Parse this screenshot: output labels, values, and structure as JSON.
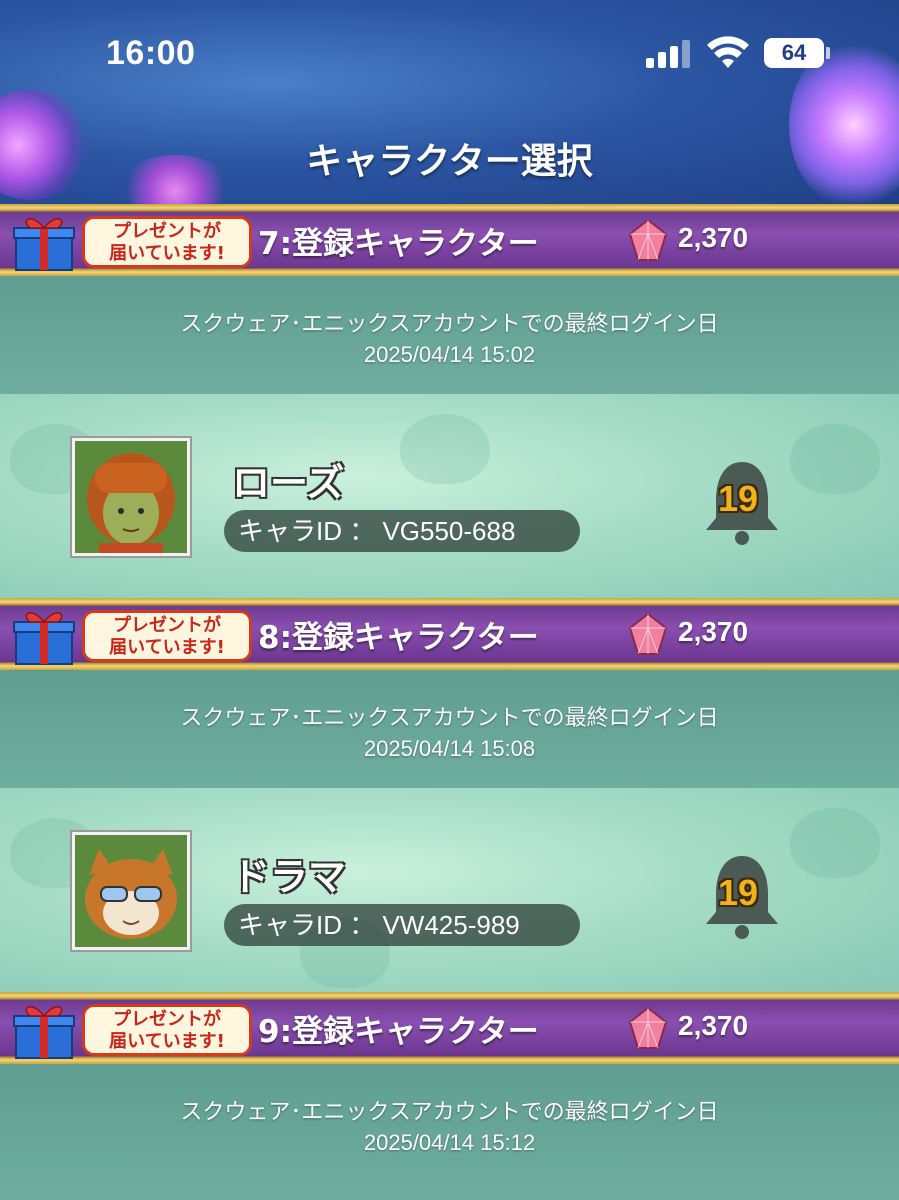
{
  "status_bar": {
    "time": "16:00",
    "battery": "64"
  },
  "header": {
    "title": "キャラクター選択"
  },
  "present_badge": {
    "line1": "プレゼントが",
    "line2": "届いています!"
  },
  "login_label": "スクウェア･エニックスアカウントでの最終ログイン日",
  "sections": [
    {
      "slot_title": "7:登録キャラクター",
      "gems": "2,370",
      "last_login": "2025/04/14  15:02",
      "character": {
        "name": "ローズ",
        "id_text": "キャラID ： VG550-688",
        "level": "19"
      }
    },
    {
      "slot_title": "8:登録キャラクター",
      "gems": "2,370",
      "last_login": "2025/04/14  15:08",
      "character": {
        "name": "ドラマ",
        "id_text": "キャラID ： VW425-989",
        "level": "19"
      }
    },
    {
      "slot_title": "9:登録キャラクター",
      "gems": "2,370",
      "last_login": "2025/04/14  15:12"
    }
  ],
  "colors": {
    "banner_purple": "#7a42a0",
    "gold_trim": "#e6c35a",
    "badge_red": "#d23b1c",
    "bell_number": "#f2b21a"
  },
  "icons": [
    "signal-icon",
    "wifi-icon",
    "battery-icon",
    "gift-icon",
    "gem-icon",
    "bell-icon"
  ]
}
